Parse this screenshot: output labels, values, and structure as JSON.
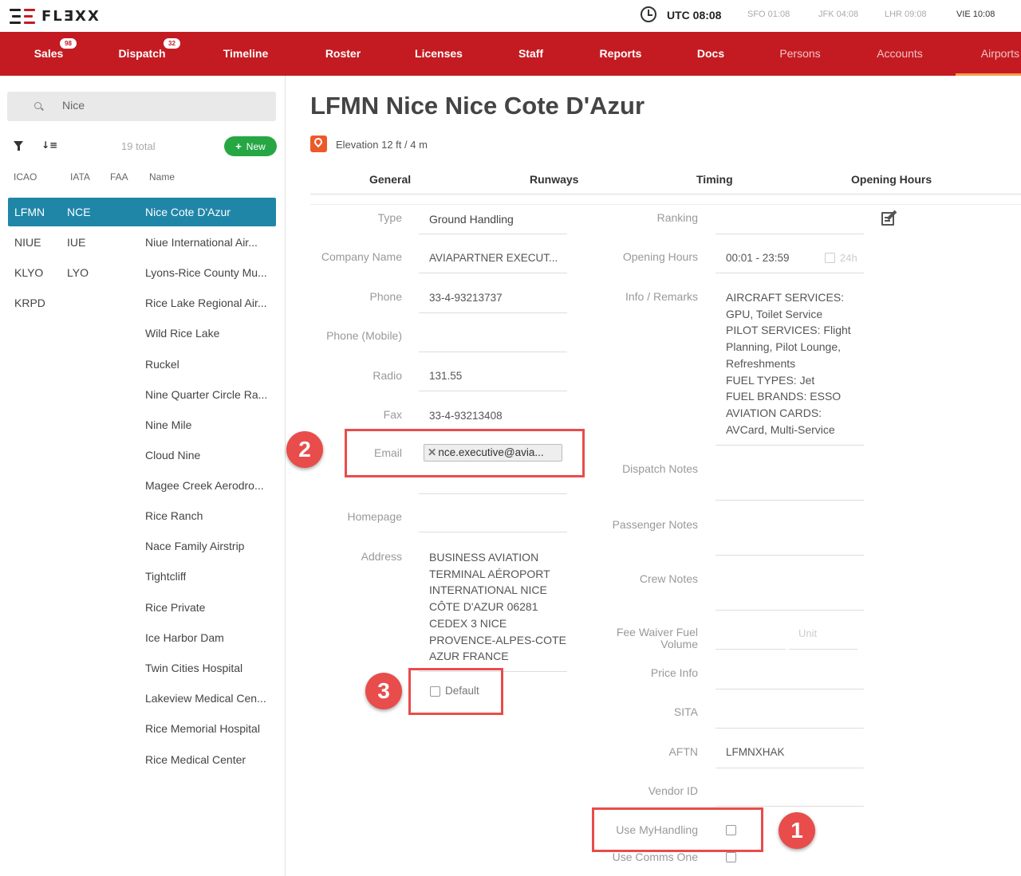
{
  "app": {
    "logo_text": "FLƎXX"
  },
  "clock": {
    "utc": "UTC 08:08",
    "zones": [
      "SFO 01:08",
      "JFK 04:08",
      "LHR 09:08",
      "VIE 10:08"
    ]
  },
  "nav": {
    "items": [
      {
        "label": "Sales",
        "badge": "98"
      },
      {
        "label": "Dispatch",
        "badge": "32"
      },
      {
        "label": "Timeline"
      },
      {
        "label": "Roster"
      },
      {
        "label": "Licenses"
      },
      {
        "label": "Staff"
      },
      {
        "label": "Reports"
      },
      {
        "label": "Docs"
      },
      {
        "label": "Persons"
      },
      {
        "label": "Accounts"
      },
      {
        "label": "Airports"
      }
    ]
  },
  "sidebar": {
    "search_value": "Nice",
    "total": "19 total",
    "new_label": "New",
    "columns": [
      "ICAO",
      "IATA",
      "FAA",
      "Name"
    ],
    "rows": [
      {
        "icao": "LFMN",
        "iata": "NCE",
        "name": "Nice Cote D'Azur"
      },
      {
        "icao": "NIUE",
        "iata": "IUE",
        "name": "Niue International Air..."
      },
      {
        "icao": "KLYO",
        "iata": "LYO",
        "name": "Lyons-Rice County Mu..."
      },
      {
        "icao": "KRPD",
        "iata": "",
        "name": "Rice Lake Regional Air..."
      },
      {
        "icao": "",
        "iata": "",
        "name": "Wild Rice Lake"
      },
      {
        "icao": "",
        "iata": "",
        "name": "Ruckel"
      },
      {
        "icao": "",
        "iata": "",
        "name": "Nine Quarter Circle Ra..."
      },
      {
        "icao": "",
        "iata": "",
        "name": "Nine Mile"
      },
      {
        "icao": "",
        "iata": "",
        "name": "Cloud Nine"
      },
      {
        "icao": "",
        "iata": "",
        "name": "Magee Creek Aerodro..."
      },
      {
        "icao": "",
        "iata": "",
        "name": "Rice Ranch"
      },
      {
        "icao": "",
        "iata": "",
        "name": "Nace Family Airstrip"
      },
      {
        "icao": "",
        "iata": "",
        "name": "Tightcliff"
      },
      {
        "icao": "",
        "iata": "",
        "name": "Rice Private"
      },
      {
        "icao": "",
        "iata": "",
        "name": "Ice Harbor Dam"
      },
      {
        "icao": "",
        "iata": "",
        "name": "Twin Cities Hospital"
      },
      {
        "icao": "",
        "iata": "",
        "name": "Lakeview Medical Cen..."
      },
      {
        "icao": "",
        "iata": "",
        "name": "Rice Memorial Hospital"
      },
      {
        "icao": "",
        "iata": "",
        "name": "Rice Medical Center"
      }
    ]
  },
  "airport": {
    "title": "LFMN Nice Nice Cote D'Azur",
    "elevation": "Elevation 12 ft / 4 m",
    "tabs": [
      "General",
      "Runways",
      "Timing",
      "Opening Hours"
    ]
  },
  "form_left": {
    "type_label": "Type",
    "type_value": "Ground Handling",
    "company_label": "Company Name",
    "company_value": "AVIAPARTNER EXECUT...",
    "phone_label": "Phone",
    "phone_value": "33-4-93213737",
    "mobile_label": "Phone (Mobile)",
    "mobile_value": "",
    "radio_label": "Radio",
    "radio_value": "131.55",
    "fax_label": "Fax",
    "fax_value": "33-4-93213408",
    "email_label": "Email",
    "email_value": "nce.executive@avia...",
    "homepage_label": "Homepage",
    "homepage_value": "",
    "address_label": "Address",
    "address_lines": [
      "BUSINESS AVIATION",
      "TERMINAL AÉROPORT",
      "INTERNATIONAL NICE",
      "CÔTE D'AZUR 06281",
      "CEDEX 3 NICE",
      "PROVENCE-ALPES-COTE",
      "AZUR FRANCE"
    ],
    "default_label": "Default"
  },
  "form_right": {
    "ranking_label": "Ranking",
    "ranking_value": "",
    "opening_label": "Opening Hours",
    "opening_value": "00:01 - 23:59",
    "h24_label": "24h",
    "info_label": "Info / Remarks",
    "info_lines": [
      "AIRCRAFT SERVICES:",
      "GPU, Toilet Service",
      "PILOT SERVICES: Flight",
      "Planning, Pilot Lounge,",
      "Refreshments",
      "FUEL TYPES: Jet",
      "FUEL BRANDS: ESSO",
      "AVIATION CARDS:",
      "AVCard, Multi-Service"
    ],
    "dispatch_label": "Dispatch Notes",
    "passenger_label": "Passenger Notes",
    "crew_label": "Crew Notes",
    "fee_label_1": "Fee Waiver Fuel",
    "fee_label_2": "Volume",
    "unit_placeholder": "Unit",
    "price_label": "Price Info",
    "sita_label": "SITA",
    "aftn_label": "AFTN",
    "aftn_value": "LFMNXHAK",
    "vendor_label": "Vendor ID",
    "myhandling_label": "Use MyHandling",
    "comms_label": "Use Comms One"
  },
  "callouts": [
    "1",
    "2",
    "3"
  ]
}
